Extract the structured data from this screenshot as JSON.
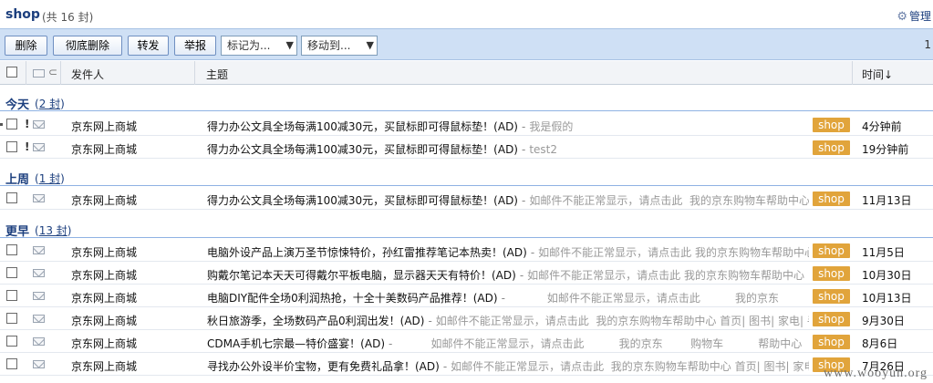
{
  "title": {
    "folder": "shop",
    "count": "(共 16 封)"
  },
  "manage": {
    "label": "管理",
    "icon": "gear-icon"
  },
  "toolbar": {
    "delete": "删除",
    "delete_forever": "彻底删除",
    "forward": "转发",
    "report": "举报",
    "mark_as": "标记为...",
    "move_to": "移动到...",
    "pager": "1"
  },
  "header": {
    "sender": "发件人",
    "subject": "主题",
    "time": "时间↓"
  },
  "groups": [
    {
      "label": "今天",
      "count": "2 封",
      "rows": [
        {
          "important": "!",
          "sender": "京东网上商城",
          "subject": "得力办公文具全场每满100减30元，买鼠标即可得鼠标垫！(AD)",
          "preview": "我是假的",
          "tag": "shop",
          "time": "4分钟前"
        },
        {
          "important": "!",
          "sender": "京东网上商城",
          "subject": "得力办公文具全场每满100减30元，买鼠标即可得鼠标垫！(AD)",
          "preview": "test2",
          "tag": "shop",
          "time": "19分钟前"
        }
      ]
    },
    {
      "label": "上周",
      "count": "1 封",
      "rows": [
        {
          "important": "",
          "sender": "京东网上商城",
          "subject": "得力办公文具全场每满100减30元，买鼠标即可得鼠标垫！(AD)",
          "preview": "如邮件不能正常显示，请点击此  我的京东购物车帮助中心 首",
          "tag": "shop",
          "time": "11月13日"
        }
      ]
    },
    {
      "label": "更早",
      "count": "13 封",
      "rows": [
        {
          "important": "",
          "sender": "京东网上商城",
          "subject": "电脑外设产品上演万圣节惊悚特价，孙红雷推荐笔记本热卖！(AD)",
          "preview": "如邮件不能正常显示，请点击此 我的京东购物车帮助中心",
          "tag": "shop",
          "time": "11月5日"
        },
        {
          "important": "",
          "sender": "京东网上商城",
          "subject": "购戴尔笔记本天天可得戴尔平板电脑，显示器天天有特价！(AD)",
          "preview": "如邮件不能正常显示，请点击此 我的京东购物车帮助中心",
          "tag": "shop",
          "time": "10月30日"
        },
        {
          "important": "",
          "sender": "京东网上商城",
          "subject": "电脑DIY配件全场0利润热抢，十全十美数码产品推荐！(AD)",
          "preview": "           如邮件不能正常显示，请点击此          我的京东",
          "tag": "shop",
          "time": "10月13日"
        },
        {
          "important": "",
          "sender": "京东网上商城",
          "subject": "秋日旅游季，全场数码产品0利润出发！(AD)",
          "preview": "如邮件不能正常显示，请点击此  我的京东购物车帮助中心 首页| 图书| 家电| 手",
          "tag": "shop",
          "time": "9月30日"
        },
        {
          "important": "",
          "sender": "京东网上商城",
          "subject": "CDMA手机七宗最—特价盛宴！(AD)",
          "preview": "          如邮件不能正常显示，请点击此          我的京东        购物车          帮助中心",
          "tag": "shop",
          "time": "8月6日"
        },
        {
          "important": "",
          "sender": "京东网上商城",
          "subject": "寻找办公外设半价宝物，更有免费礼品拿！(AD)",
          "preview": "如邮件不能正常显示，请点击此  我的京东购物车帮助中心 首页| 图书| 家电| 手",
          "tag": "shop",
          "time": "7月26日"
        }
      ]
    }
  ],
  "watermark": "www.wooyun.org"
}
